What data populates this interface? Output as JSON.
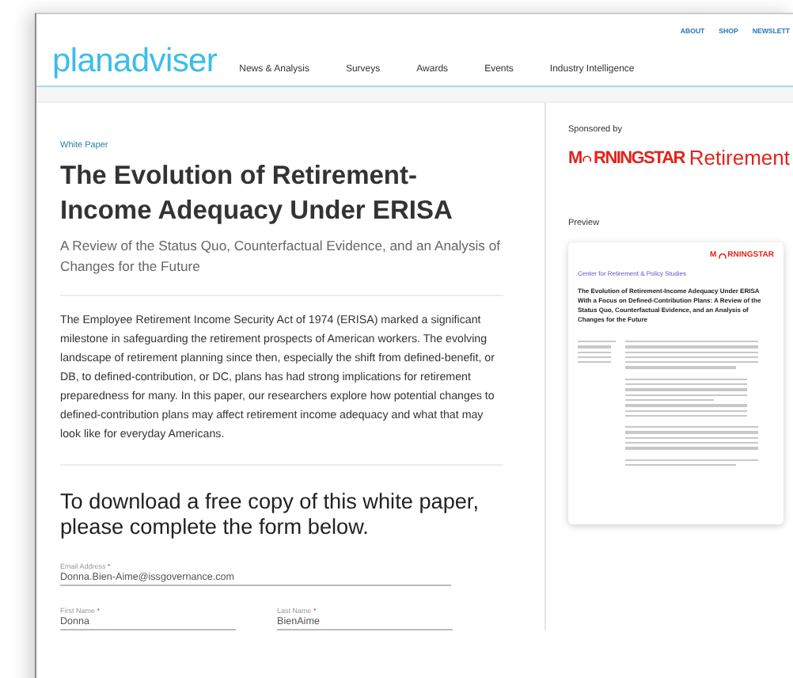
{
  "top_links": [
    "ABOUT",
    "SHOP",
    "NEWSLETT"
  ],
  "logo": "planadviser",
  "nav": [
    "News & Analysis",
    "Surveys",
    "Awards",
    "Events",
    "Industry Intelligence"
  ],
  "article": {
    "category": "White Paper",
    "title": "The Evolution of Retirement-Income Adequacy Under ERISA",
    "subtitle": "A Review of the Status Quo, Counterfactual Evidence, and an Analysis of Changes for the Future",
    "body": "The Employee Retirement Income Security Act of 1974 (ERISA) marked a significant milestone in safeguarding the retirement prospects of American workers. The evolving landscape of retirement planning since then, especially the shift from defined-benefit, or DB, to defined-contribution, or DC, plans has had strong implications for retirement preparedness for many. In this paper, our researchers explore how potential changes to defined-contribution plans may affect retirement income adequacy and what that may look like for everyday Americans."
  },
  "form": {
    "required_mark": "*",
    "heading": "To download a free copy of this white paper, please complete the form below.",
    "fields": [
      {
        "label": "Email Address",
        "required": true,
        "value": "Donna.Bien-Aime@issgovernance.com",
        "kind": "wide"
      },
      {
        "label": "First Name",
        "required": true,
        "value": "Donna",
        "kind": "half"
      },
      {
        "label": "Last Name",
        "required": true,
        "value": "BienAime",
        "kind": "half"
      }
    ]
  },
  "sidebar": {
    "sponsored_label": "Sponsored by",
    "sponsor_logo": {
      "left": "M",
      "right": "RNINGSTAR",
      "suffix": "Retirement"
    },
    "preview_label": "Preview",
    "preview": {
      "logo": {
        "left": "M",
        "right": "RNINGSTAR"
      },
      "kicker": "Center for Retirement & Policy Studies",
      "title": "The Evolution of Retirement-Income Adequacy Under ERISA With a Focus on Defined-Contribution Plans: A Review of the Status Quo, Counterfactual Evidence, and an Analysis of Changes for the Future"
    }
  }
}
